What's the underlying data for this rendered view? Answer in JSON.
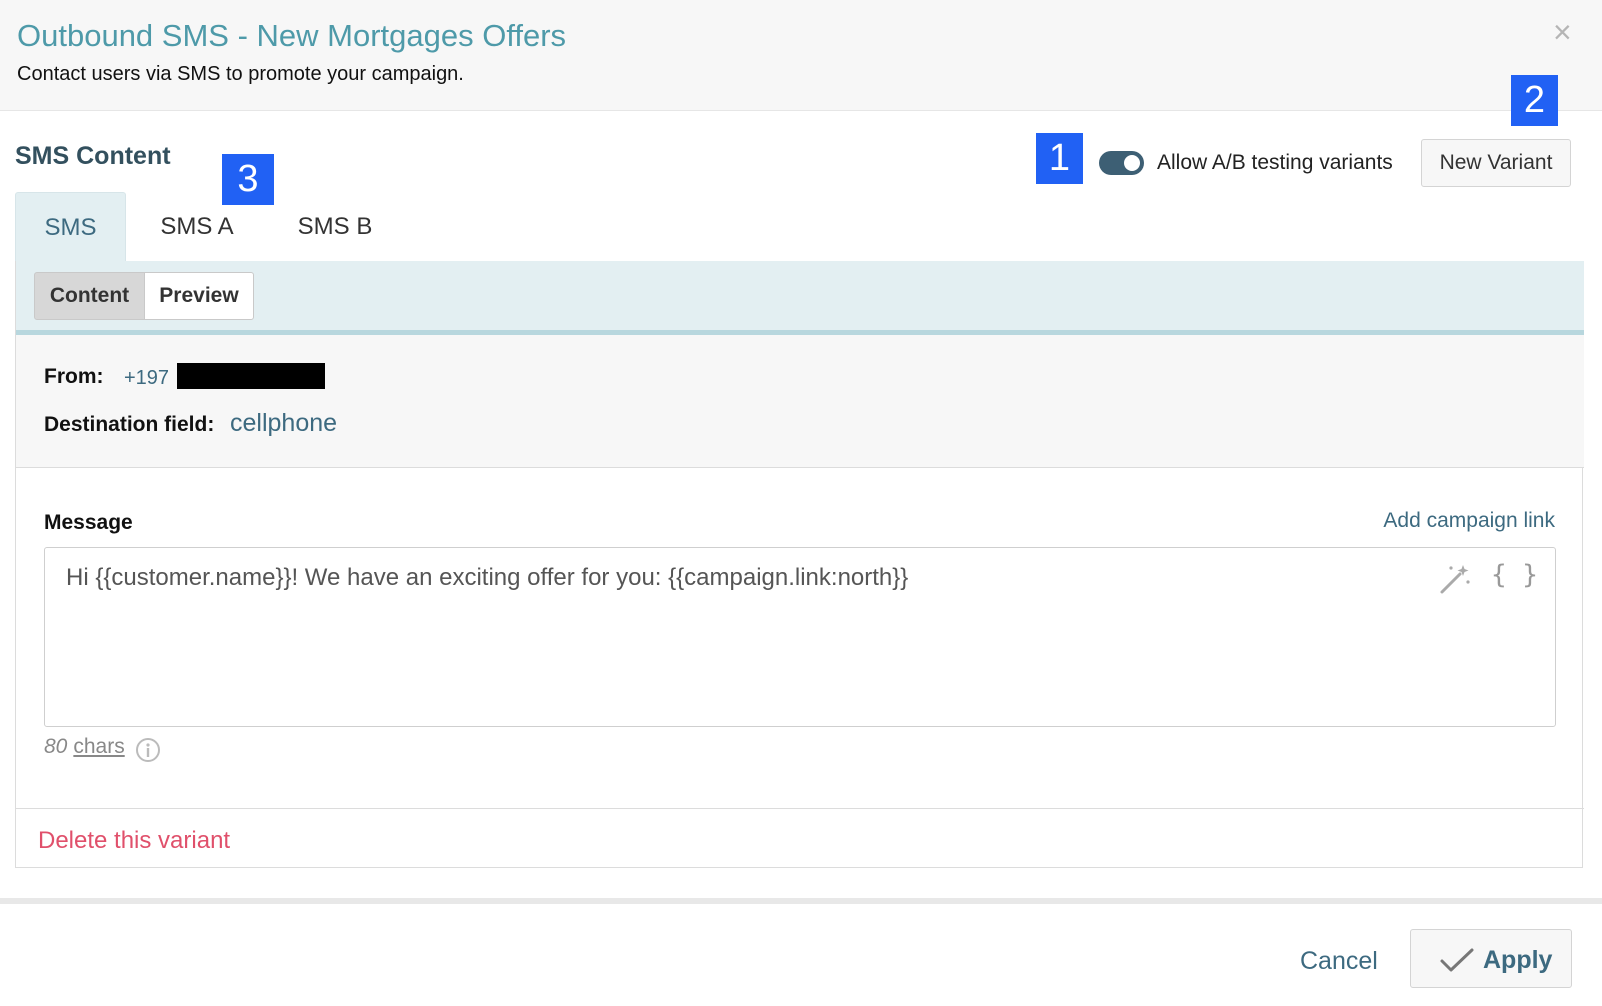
{
  "dialog": {
    "title": "Outbound SMS - New Mortgages Offers",
    "subtitle": "Contact users via SMS to promote your campaign.",
    "close_icon": "×"
  },
  "annotations": {
    "badge1": "1",
    "badge2": "2",
    "badge3": "3"
  },
  "content_section": {
    "title": "SMS Content",
    "ab_toggle": {
      "label": "Allow A/B testing variants",
      "checked": true
    },
    "new_variant_label": "New Variant",
    "tabs": [
      {
        "label": "SMS",
        "active": true
      },
      {
        "label": "SMS A",
        "active": false
      },
      {
        "label": "SMS B",
        "active": false
      }
    ]
  },
  "editor": {
    "modes": {
      "content": "Content",
      "preview": "Preview",
      "selected": "Content"
    },
    "from_label": "From:",
    "from_value": "+197",
    "destination_label": "Destination field:",
    "destination_value": "cellphone",
    "message_label": "Message",
    "add_campaign_link": "Add campaign link",
    "message_text": "Hi {{customer.name}}! We have an exciting offer for you: {{campaign.link:north}}",
    "braces_icon": "{ }",
    "char_count": "80",
    "char_unit": "chars",
    "delete_variant": "Delete this variant"
  },
  "footer": {
    "cancel_label": "Cancel",
    "apply_label": "Apply"
  },
  "colors": {
    "accent": "#3d6a80",
    "title": "#4e9aa9",
    "danger": "#e0506b",
    "annotation": "#2161f4"
  }
}
